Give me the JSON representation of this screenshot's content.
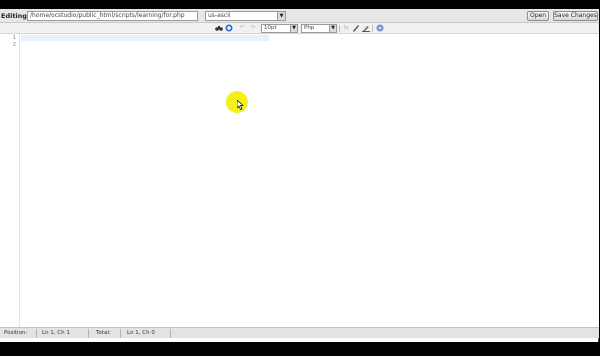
{
  "topbar": {
    "editing_label": "Editing:",
    "file_path": "/home/ocstudio/public_html/scripts/learning/for.php",
    "encoding": "us-ascii",
    "open_label": "Open",
    "save_label": "Save Changes"
  },
  "toolbar": {
    "font_size": "10pt",
    "language": "Php",
    "icons": [
      "binoculars-icon",
      "search-replace-icon",
      "undo-icon",
      "redo-icon",
      "wrap-icon",
      "highlight-icon",
      "clear-icon",
      "help-icon"
    ]
  },
  "editor": {
    "line_numbers": [
      "1",
      "2"
    ]
  },
  "status": {
    "position_label": "Position:",
    "position_value": "Ln 1, Ch 1",
    "total_label": "Total:",
    "total_value": "Ln 1, Ch 0"
  },
  "colors": {
    "active_line": "#e6f1fb",
    "cursor_highlight": "#f6f01a"
  }
}
